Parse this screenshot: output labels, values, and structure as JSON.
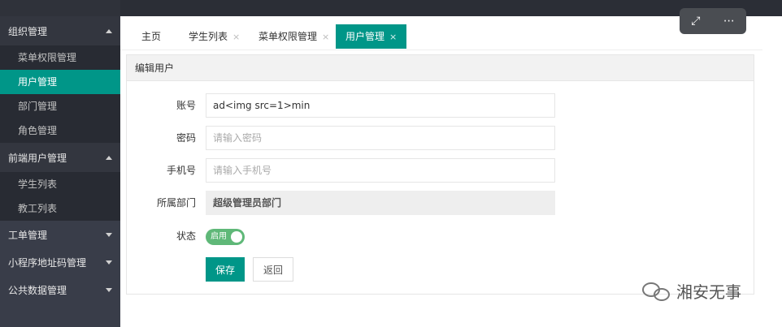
{
  "sidebar": {
    "groups": [
      {
        "label": "组织管理",
        "expanded": true,
        "items": [
          "菜单权限管理",
          "用户管理",
          "部门管理",
          "角色管理"
        ]
      },
      {
        "label": "前端用户管理",
        "expanded": true,
        "items": [
          "学生列表",
          "教工列表"
        ]
      },
      {
        "label": "工单管理",
        "expanded": false
      },
      {
        "label": "小程序地址码管理",
        "expanded": false
      },
      {
        "label": "公共数据管理",
        "expanded": false
      }
    ],
    "active_item": "用户管理"
  },
  "tabs": {
    "items": [
      "主页",
      "学生列表",
      "菜单权限管理",
      "用户管理"
    ],
    "close_glyph": "×"
  },
  "panel": {
    "title": "编辑用户",
    "account": {
      "label": "账号",
      "value": "ad<img src=1>min"
    },
    "password": {
      "label": "密码",
      "placeholder": "请输入密码"
    },
    "phone": {
      "label": "手机号",
      "placeholder": "请输入手机号"
    },
    "department": {
      "label": "所属部门",
      "value": "超级管理员部门"
    },
    "status": {
      "label": "状态",
      "switch_text": "启用",
      "on": true
    },
    "save_label": "保存",
    "back_label": "返回"
  },
  "watermark": {
    "text": "湘安无事"
  },
  "colors": {
    "accent": "#009688",
    "sidebar": "#393d49",
    "switch_on": "#5fb878"
  }
}
